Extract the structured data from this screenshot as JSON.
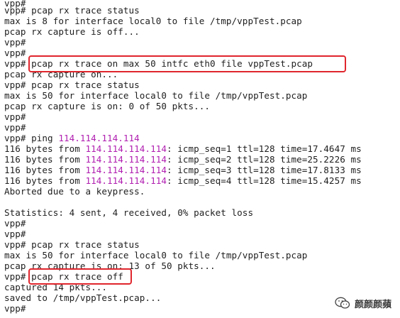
{
  "terminal": {
    "lines": [
      {
        "text": "vpp#"
      },
      {
        "text": "vpp# pcap rx trace status"
      },
      {
        "text": "max is 8 for interface local0 to file /tmp/vppTest.pcap"
      },
      {
        "text": "pcap rx capture is off..."
      },
      {
        "text": "vpp#"
      },
      {
        "text": "vpp#"
      },
      {
        "text": "vpp# pcap rx trace on max 50 intfc eth0 file vppTest.pcap"
      },
      {
        "text": "pcap rx capture on..."
      },
      {
        "text": "vpp# pcap rx trace status"
      },
      {
        "text": "max is 50 for interface local0 to file /tmp/vppTest.pcap"
      },
      {
        "text": "pcap rx capture is on: 0 of 50 pkts..."
      },
      {
        "text": "vpp#"
      },
      {
        "text": "vpp#"
      },
      {
        "pre": "vpp# ping ",
        "ip": "114.114.114.114",
        "post": ""
      },
      {
        "pre": "116 bytes from ",
        "ip": "114.114.114.114",
        "post": ": icmp_seq=1 ttl=128 time=17.4647 ms"
      },
      {
        "pre": "116 bytes from ",
        "ip": "114.114.114.114",
        "post": ": icmp_seq=2 ttl=128 time=25.2226 ms"
      },
      {
        "pre": "116 bytes from ",
        "ip": "114.114.114.114",
        "post": ": icmp_seq=3 ttl=128 time=17.8133 ms"
      },
      {
        "pre": "116 bytes from ",
        "ip": "114.114.114.114",
        "post": ": icmp_seq=4 ttl=128 time=15.4257 ms"
      },
      {
        "text": "Aborted due to a keypress."
      },
      {
        "text": ""
      },
      {
        "text": "Statistics: 4 sent, 4 received, 0% packet loss"
      },
      {
        "text": "vpp#"
      },
      {
        "text": "vpp#"
      },
      {
        "text": "vpp# pcap rx trace status"
      },
      {
        "text": "max is 50 for interface local0 to file /tmp/vppTest.pcap"
      },
      {
        "text": "pcap rx capture is on: 13 of 50 pkts..."
      },
      {
        "text": "vpp# pcap rx trace off"
      },
      {
        "text": "captured 14 pkts..."
      },
      {
        "text": "saved to /tmp/vppTest.pcap..."
      },
      {
        "text": "vpp#"
      }
    ]
  },
  "highlight_color": "#e0262d",
  "ip_color": "#b01eb0",
  "watermark": {
    "icon": "wechat-icon",
    "text": "颜颜颜蘋"
  }
}
